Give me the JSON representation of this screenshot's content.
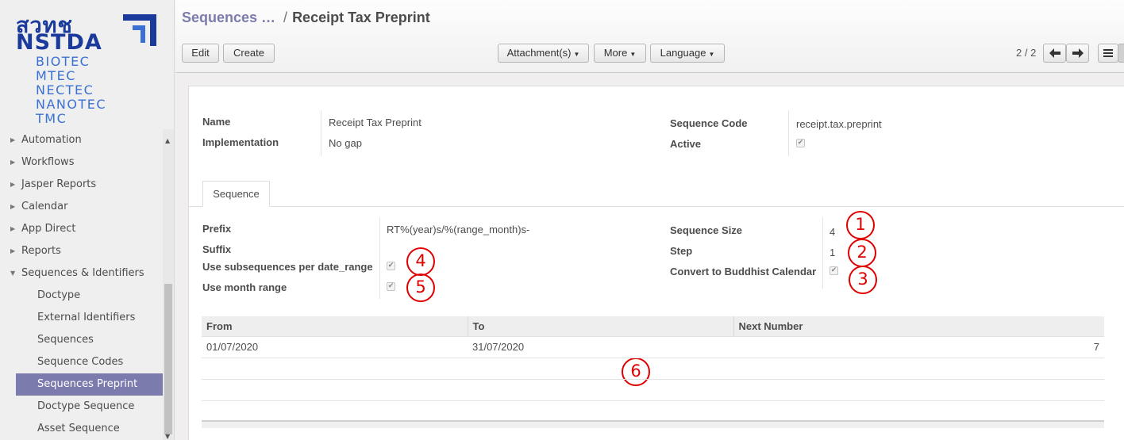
{
  "logo": {
    "brand_lines": [
      "สวทช",
      "NSTDA"
    ],
    "units": [
      "BIOTEC",
      "MTEC",
      "NECTEC",
      "NANOTEC",
      "TMC"
    ]
  },
  "sidebar": {
    "items": [
      {
        "label": "Automation",
        "state": "collapsed"
      },
      {
        "label": "Workflows",
        "state": "collapsed"
      },
      {
        "label": "Jasper Reports",
        "state": "collapsed"
      },
      {
        "label": "Calendar",
        "state": "collapsed"
      },
      {
        "label": "App Direct",
        "state": "collapsed"
      },
      {
        "label": "Reports",
        "state": "collapsed"
      },
      {
        "label": "Sequences & Identifiers",
        "state": "expanded"
      }
    ],
    "subitems": [
      {
        "label": "Doctype"
      },
      {
        "label": "External Identifiers"
      },
      {
        "label": "Sequences"
      },
      {
        "label": "Sequence Codes"
      },
      {
        "label": "Sequences Preprint",
        "active": true
      },
      {
        "label": "Doctype Sequence"
      },
      {
        "label": "Asset Sequence"
      }
    ]
  },
  "breadcrumb": {
    "parent": "Sequences …",
    "separator": "/",
    "current": "Receipt Tax Preprint"
  },
  "toolbar": {
    "edit_label": "Edit",
    "create_label": "Create",
    "attachments_label": "Attachment(s)",
    "more_label": "More",
    "language_label": "Language",
    "pager": "2 / 2"
  },
  "form": {
    "name_label": "Name",
    "name_value": "Receipt Tax Preprint",
    "implementation_label": "Implementation",
    "implementation_value": "No gap",
    "sequence_code_label": "Sequence Code",
    "sequence_code_value": "receipt.tax.preprint",
    "active_label": "Active",
    "active_checked": true
  },
  "tab": {
    "label": "Sequence"
  },
  "sequence": {
    "prefix_label": "Prefix",
    "prefix_value": "RT%(year)s/%(range_month)s-",
    "suffix_label": "Suffix",
    "suffix_value": "",
    "use_subsequences_label": "Use subsequences per date_range",
    "use_subsequences_checked": true,
    "use_month_range_label": "Use month range",
    "use_month_range_checked": true,
    "size_label": "Sequence Size",
    "size_value": "4",
    "step_label": "Step",
    "step_value": "1",
    "buddhist_label": "Convert to Buddhist Calendar",
    "buddhist_checked": true
  },
  "annotations": [
    "1",
    "2",
    "3",
    "4",
    "5",
    "6"
  ],
  "annotation_color": "#e00000",
  "date_ranges": {
    "columns": [
      "From",
      "To",
      "Next Number"
    ],
    "rows": [
      {
        "from": "01/07/2020",
        "to": "31/07/2020",
        "next": "7"
      }
    ]
  },
  "colors": {
    "accent": "#7c7bad",
    "brand_dark_blue": "#1a3a9c",
    "brand_light_blue": "#3a70d4"
  }
}
